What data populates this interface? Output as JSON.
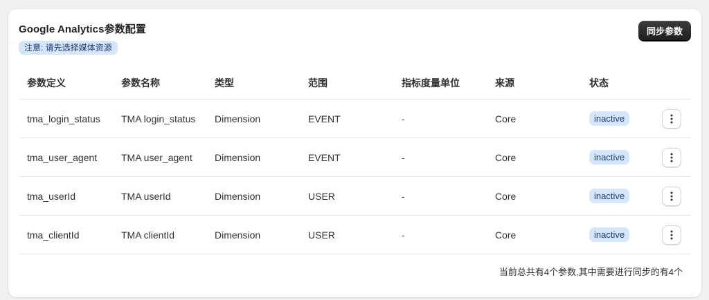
{
  "panel": {
    "title": "Google Analytics参数配置",
    "notice": "注意: 请先选择媒体资源",
    "sync_button": "同步参数"
  },
  "table": {
    "columns": [
      "参数定义",
      "参数名称",
      "类型",
      "范围",
      "指标度量单位",
      "来源",
      "状态"
    ],
    "rows": [
      {
        "definition": "tma_login_status",
        "name": "TMA login_status",
        "type": "Dimension",
        "scope": "EVENT",
        "unit": "-",
        "source": "Core",
        "status": "inactive"
      },
      {
        "definition": "tma_user_agent",
        "name": "TMA user_agent",
        "type": "Dimension",
        "scope": "EVENT",
        "unit": "-",
        "source": "Core",
        "status": "inactive"
      },
      {
        "definition": "tma_userId",
        "name": "TMA userId",
        "type": "Dimension",
        "scope": "USER",
        "unit": "-",
        "source": "Core",
        "status": "inactive"
      },
      {
        "definition": "tma_clientId",
        "name": "TMA clientId",
        "type": "Dimension",
        "scope": "USER",
        "unit": "-",
        "source": "Core",
        "status": "inactive"
      }
    ],
    "row_action_icon": "vertical-ellipsis-icon"
  },
  "footer": {
    "summary": "当前总共有4个参数,其中需要进行同步的有4个"
  },
  "colors": {
    "badge_bg": "#d4e6fb",
    "badge_text": "#23406b",
    "button_bg": "#1f1f1f"
  }
}
